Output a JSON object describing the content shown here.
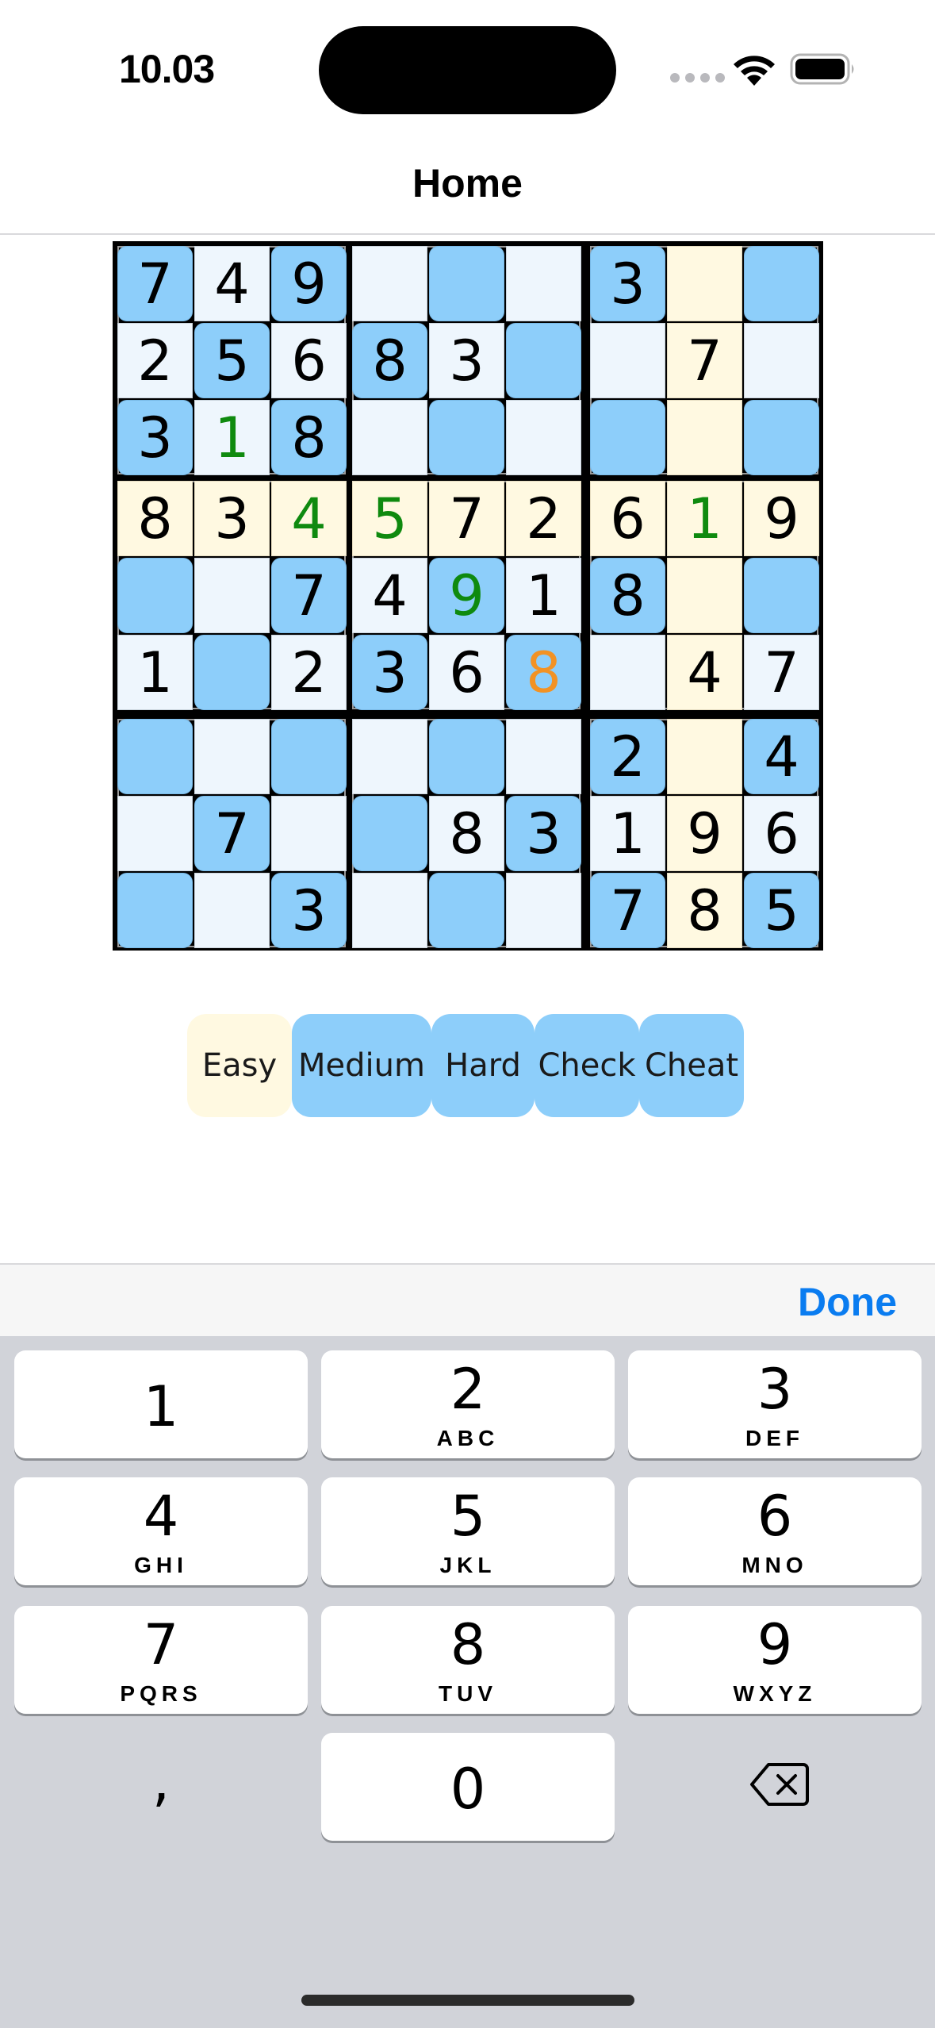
{
  "status_bar": {
    "time": "10.03"
  },
  "nav": {
    "title": "Home"
  },
  "board": {
    "rows": [
      [
        {
          "v": "7",
          "t": "dark"
        },
        {
          "v": "4",
          "t": "light"
        },
        {
          "v": "9",
          "t": "dark"
        },
        {
          "v": "",
          "t": "light"
        },
        {
          "v": "",
          "t": "dark"
        },
        {
          "v": "",
          "t": "light"
        },
        {
          "v": "3",
          "t": "dark"
        },
        {
          "v": "",
          "t": "cream"
        },
        {
          "v": "",
          "t": "dark"
        }
      ],
      [
        {
          "v": "2",
          "t": "light"
        },
        {
          "v": "5",
          "t": "dark"
        },
        {
          "v": "6",
          "t": "light"
        },
        {
          "v": "8",
          "t": "dark"
        },
        {
          "v": "3",
          "t": "light"
        },
        {
          "v": "",
          "t": "dark"
        },
        {
          "v": "",
          "t": "light"
        },
        {
          "v": "7",
          "t": "cream"
        },
        {
          "v": "",
          "t": "light"
        }
      ],
      [
        {
          "v": "3",
          "t": "dark"
        },
        {
          "v": "1",
          "t": "light",
          "c": "green"
        },
        {
          "v": "8",
          "t": "dark"
        },
        {
          "v": "",
          "t": "light"
        },
        {
          "v": "",
          "t": "dark"
        },
        {
          "v": "",
          "t": "light"
        },
        {
          "v": "",
          "t": "dark"
        },
        {
          "v": "",
          "t": "cream"
        },
        {
          "v": "",
          "t": "dark"
        }
      ],
      [
        {
          "v": "8",
          "t": "cream"
        },
        {
          "v": "3",
          "t": "cream"
        },
        {
          "v": "4",
          "t": "cream",
          "c": "green"
        },
        {
          "v": "5",
          "t": "cream",
          "c": "green"
        },
        {
          "v": "7",
          "t": "cream"
        },
        {
          "v": "2",
          "t": "cream"
        },
        {
          "v": "6",
          "t": "cream"
        },
        {
          "v": "1",
          "t": "cream",
          "c": "green"
        },
        {
          "v": "9",
          "t": "cream"
        }
      ],
      [
        {
          "v": "",
          "t": "dark"
        },
        {
          "v": "",
          "t": "light"
        },
        {
          "v": "7",
          "t": "dark"
        },
        {
          "v": "4",
          "t": "light"
        },
        {
          "v": "9",
          "t": "dark",
          "c": "green"
        },
        {
          "v": "1",
          "t": "light"
        },
        {
          "v": "8",
          "t": "dark"
        },
        {
          "v": "",
          "t": "cream"
        },
        {
          "v": "",
          "t": "dark"
        }
      ],
      [
        {
          "v": "1",
          "t": "light"
        },
        {
          "v": "",
          "t": "dark"
        },
        {
          "v": "2",
          "t": "light"
        },
        {
          "v": "3",
          "t": "dark"
        },
        {
          "v": "6",
          "t": "light"
        },
        {
          "v": "8",
          "t": "dark",
          "c": "orange"
        },
        {
          "v": "",
          "t": "light"
        },
        {
          "v": "4",
          "t": "cream"
        },
        {
          "v": "7",
          "t": "light"
        }
      ],
      [
        {
          "v": "",
          "t": "dark"
        },
        {
          "v": "",
          "t": "light"
        },
        {
          "v": "",
          "t": "dark"
        },
        {
          "v": "",
          "t": "light"
        },
        {
          "v": "",
          "t": "dark"
        },
        {
          "v": "",
          "t": "light"
        },
        {
          "v": "2",
          "t": "dark"
        },
        {
          "v": "",
          "t": "cream"
        },
        {
          "v": "4",
          "t": "dark"
        }
      ],
      [
        {
          "v": "",
          "t": "light"
        },
        {
          "v": "7",
          "t": "dark"
        },
        {
          "v": "",
          "t": "light"
        },
        {
          "v": "",
          "t": "dark"
        },
        {
          "v": "8",
          "t": "light"
        },
        {
          "v": "3",
          "t": "dark"
        },
        {
          "v": "1",
          "t": "light"
        },
        {
          "v": "9",
          "t": "cream"
        },
        {
          "v": "6",
          "t": "light"
        }
      ],
      [
        {
          "v": "",
          "t": "dark"
        },
        {
          "v": "",
          "t": "light"
        },
        {
          "v": "3",
          "t": "dark"
        },
        {
          "v": "",
          "t": "light"
        },
        {
          "v": "",
          "t": "dark"
        },
        {
          "v": "",
          "t": "light"
        },
        {
          "v": "7",
          "t": "dark"
        },
        {
          "v": "8",
          "t": "cream"
        },
        {
          "v": "5",
          "t": "dark"
        }
      ]
    ]
  },
  "difficulty": {
    "easy": "Easy",
    "medium": "Medium",
    "hard": "Hard",
    "check": "Check",
    "cheat": "Cheat"
  },
  "keyboard": {
    "done": "Done",
    "keys": [
      {
        "num": "1",
        "letters": ""
      },
      {
        "num": "2",
        "letters": "ABC"
      },
      {
        "num": "3",
        "letters": "DEF"
      },
      {
        "num": "4",
        "letters": "GHI"
      },
      {
        "num": "5",
        "letters": "JKL"
      },
      {
        "num": "6",
        "letters": "MNO"
      },
      {
        "num": "7",
        "letters": "PQRS"
      },
      {
        "num": "8",
        "letters": "TUV"
      },
      {
        "num": "9",
        "letters": "WXYZ"
      },
      {
        "num": "0",
        "letters": ""
      }
    ],
    "comma": ",",
    "icons": {
      "backspace": "delete-left-icon"
    }
  },
  "colors": {
    "cell_dark": "#8dcefa",
    "cell_light": "#eef6fd",
    "cell_highlight": "#fff9e1",
    "digit_correct": "#0f8a0f",
    "digit_selected": "#f29224",
    "accent": "#0a7cf0"
  }
}
